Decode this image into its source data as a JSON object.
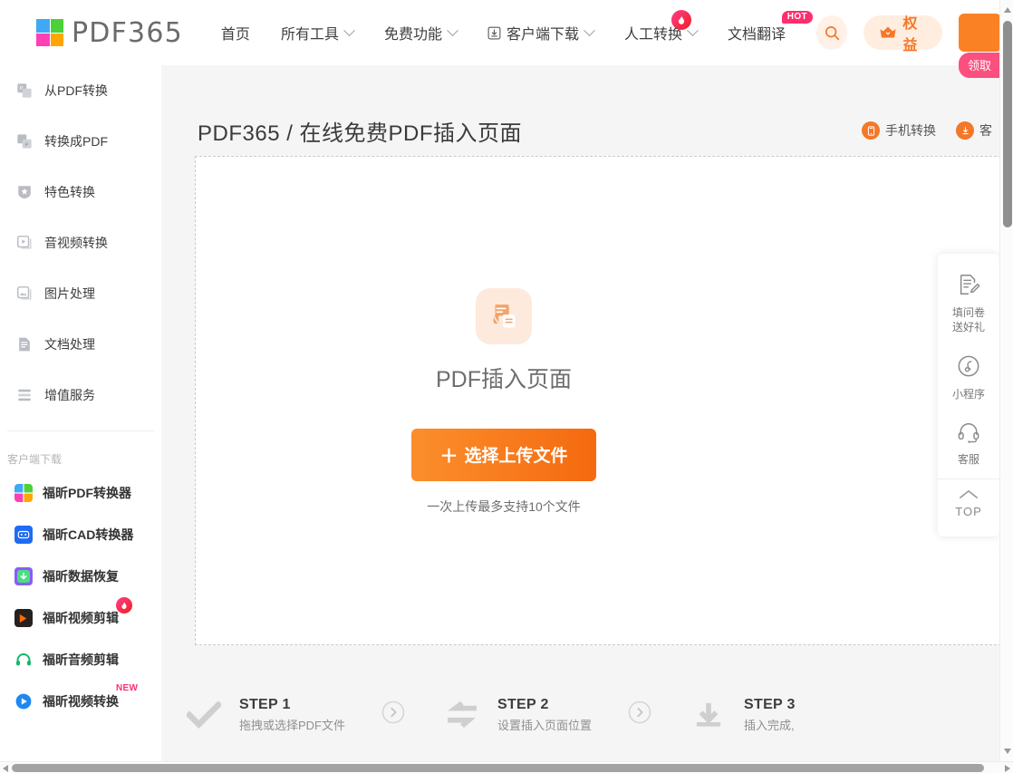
{
  "header": {
    "logo_text": "PDF365",
    "nav": [
      {
        "label": "首页",
        "caret": false,
        "icon": null,
        "badge": null
      },
      {
        "label": "所有工具",
        "caret": true,
        "icon": null,
        "badge": null
      },
      {
        "label": "免费功能",
        "caret": true,
        "icon": null,
        "badge": null
      },
      {
        "label": "客户端下载",
        "caret": true,
        "icon": "download-box-icon",
        "badge": null
      },
      {
        "label": "人工转换",
        "caret": true,
        "icon": null,
        "badge": "flame-badge"
      },
      {
        "label": "文档翻译",
        "caret": false,
        "icon": null,
        "badge": "HOT"
      }
    ],
    "search_icon": "search-icon",
    "vip_label": "权益",
    "vip_icon": "crown-icon",
    "pink_tag_label": "领取",
    "accent_orange": "#f5772a",
    "badge_pink": "#ff2d6f"
  },
  "sidebar": {
    "items": [
      {
        "label": "从PDF转换",
        "icon": "from-pdf-icon"
      },
      {
        "label": "转换成PDF",
        "icon": "to-pdf-icon"
      },
      {
        "label": "特色转换",
        "icon": "star-shield-icon"
      },
      {
        "label": "音视频转换",
        "icon": "media-icon"
      },
      {
        "label": "图片处理",
        "icon": "image-icon"
      },
      {
        "label": "文档处理",
        "icon": "document-icon"
      },
      {
        "label": "增值服务",
        "icon": "list-icon"
      }
    ],
    "section_title": "客户端下载",
    "apps": [
      {
        "label": "福昕PDF转换器",
        "icon": "foxit-pdf-icon",
        "tag": null
      },
      {
        "label": "福昕CAD转换器",
        "icon": "foxit-cad-icon",
        "tag": null
      },
      {
        "label": "福昕数据恢复",
        "icon": "foxit-recovery-icon",
        "tag": null
      },
      {
        "label": "福昕视频剪辑",
        "icon": "foxit-video-edit-icon",
        "tag": "flame"
      },
      {
        "label": "福昕音频剪辑",
        "icon": "foxit-audio-edit-icon",
        "tag": null
      },
      {
        "label": "福昕视频转换",
        "icon": "foxit-video-convert-icon",
        "tag": "NEW"
      }
    ]
  },
  "main": {
    "page_title": "PDF365 / 在线免费PDF插入页面",
    "title_actions": [
      {
        "label": "手机转换",
        "icon": "phone-icon"
      },
      {
        "label": "客",
        "icon": "download-icon"
      }
    ],
    "dropzone": {
      "icon": "pdf-insert-page-icon",
      "title": "PDF插入页面",
      "button_label": "选择上传文件",
      "button_plus": "＋",
      "hint": "一次上传最多支持10个文件"
    },
    "steps": [
      {
        "num": "STEP 1",
        "desc": "拖拽或选择PDF文件",
        "icon": "check-icon"
      },
      {
        "num": "STEP 2",
        "desc": "设置插入页面位置",
        "icon": "swap-icon"
      },
      {
        "num": "STEP 3",
        "desc": "插入完成,",
        "icon": "download-tray-icon"
      }
    ]
  },
  "floatbar": {
    "items": [
      {
        "label": "填问卷\n送好礼",
        "line1": "填问卷",
        "line2": "送好礼",
        "icon": "survey-icon"
      },
      {
        "label": "小程序",
        "line1": "小程序",
        "line2": "",
        "icon": "miniprogram-icon"
      },
      {
        "label": "客服",
        "line1": "客服",
        "line2": "",
        "icon": "headset-icon"
      }
    ],
    "top_label": "TOP",
    "top_icon": "chevron-up-icon"
  }
}
